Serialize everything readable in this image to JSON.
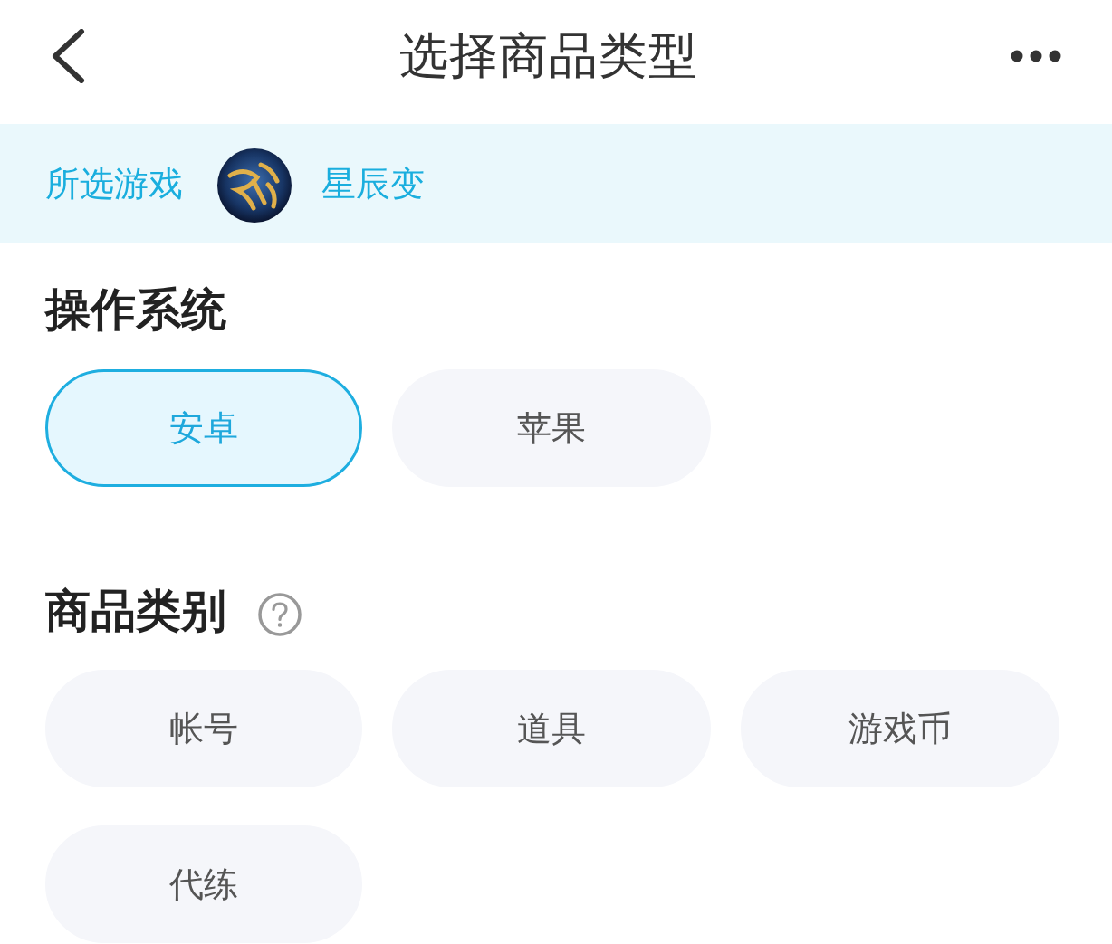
{
  "header": {
    "title": "选择商品类型"
  },
  "game_banner": {
    "label": "所选游戏",
    "game_name": "星辰变"
  },
  "sections": [
    {
      "title": "操作系统",
      "help": false,
      "options": [
        {
          "label": "安卓",
          "selected": true
        },
        {
          "label": "苹果",
          "selected": false
        }
      ]
    },
    {
      "title": "商品类别",
      "help": true,
      "options": [
        {
          "label": "帐号",
          "selected": false
        },
        {
          "label": "道具",
          "selected": false
        },
        {
          "label": "游戏币",
          "selected": false
        },
        {
          "label": "代练",
          "selected": false
        }
      ]
    }
  ]
}
